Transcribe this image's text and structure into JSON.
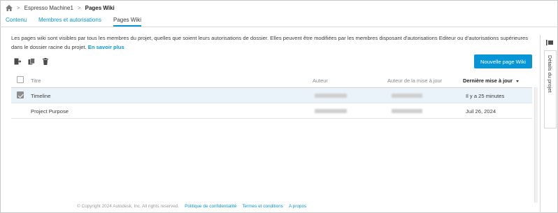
{
  "breadcrumb": {
    "items": [
      "Espresso Machine1",
      "Pages Wiki"
    ],
    "separator": ">"
  },
  "tabs": [
    {
      "label": "Contenu",
      "active": false
    },
    {
      "label": "Membres et autorisations",
      "active": false
    },
    {
      "label": "Pages Wiki",
      "active": true
    }
  ],
  "info": {
    "text": "Les pages wiki sont visibles par tous les membres du projet, quelles que soient leurs autorisations de dossier. Elles peuvent être modifiées par les membres disposant d'autorisations Editeur ou d'autorisations supérieures dans le dossier racine du projet.",
    "link": "En savoir plus"
  },
  "toolbar": {
    "icons": [
      "export-icon",
      "copy-icon",
      "delete-icon"
    ],
    "new_button": "Nouvelle page Wiki"
  },
  "table": {
    "headers": {
      "title": "Titre",
      "author": "Auteur",
      "updated_by": "Auteur de la mise à jour",
      "last_update": "Dernière mise à jour"
    },
    "rows": [
      {
        "title": "Timeline",
        "last_update": "Il y a 25 minutes",
        "selected": true
      },
      {
        "title": "Project Purpose",
        "last_update": "Juil 26, 2024",
        "selected": false
      }
    ]
  },
  "side_panel": {
    "label": "Détails du projet"
  },
  "footer": {
    "copyright": "© Copyright 2024 Autodesk, Inc. All rights reserved.",
    "links": [
      "Politique de confidentialité",
      "Termes et conditions",
      "A propos"
    ]
  },
  "colors": {
    "accent": "#0696d7",
    "selected_row": "#eaf3f9"
  }
}
